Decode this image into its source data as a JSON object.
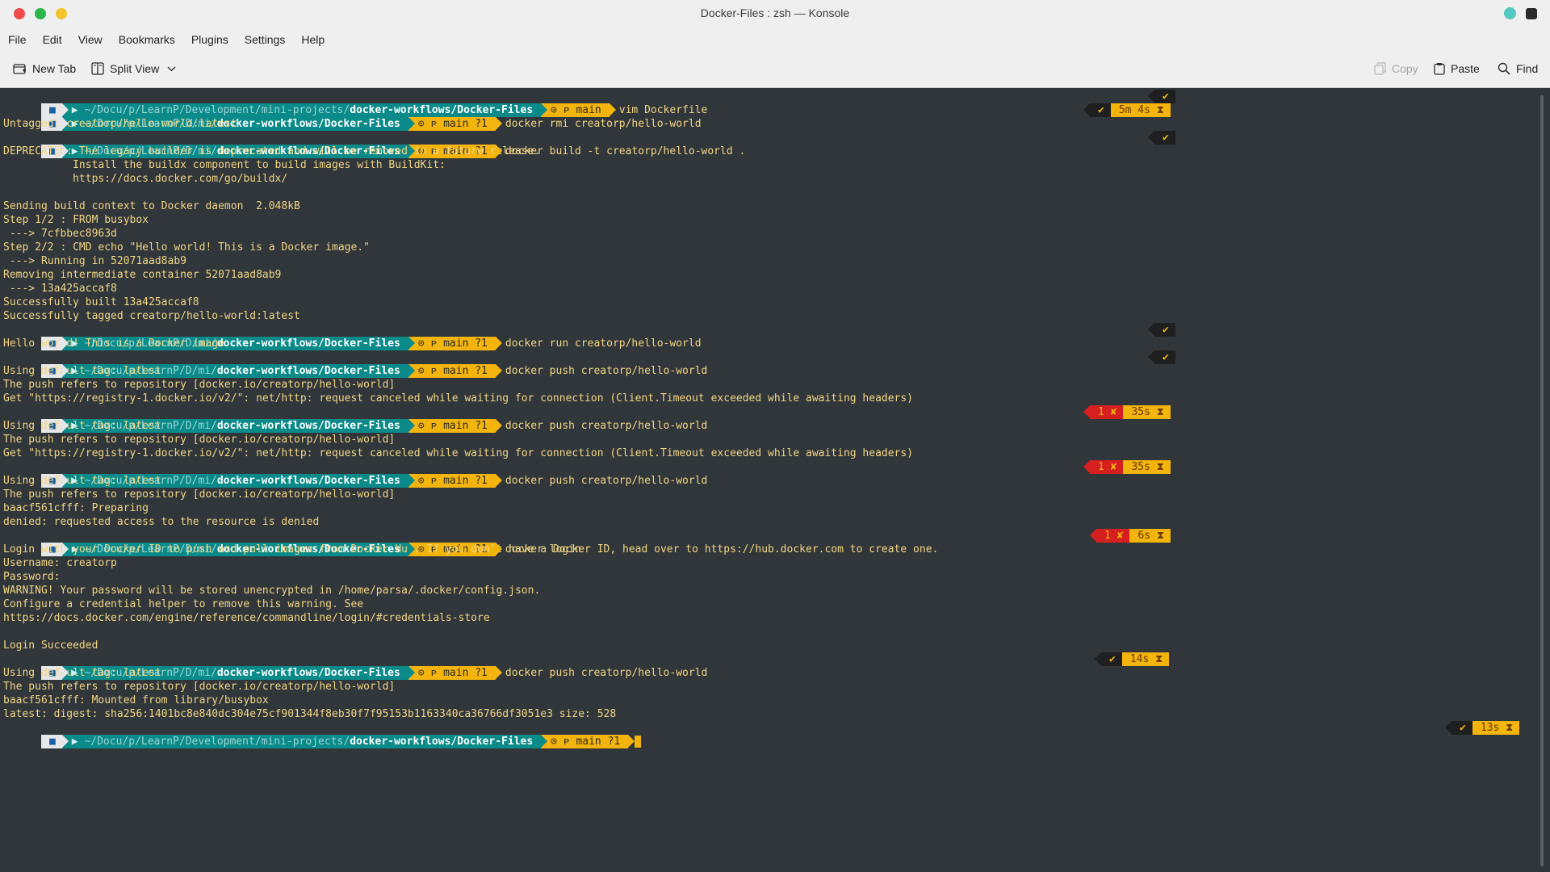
{
  "window": {
    "title": "Docker-Files : zsh — Konsole"
  },
  "menu": [
    "File",
    "Edit",
    "View",
    "Bookmarks",
    "Plugins",
    "Settings",
    "Help"
  ],
  "toolbar": {
    "new_tab": "New Tab",
    "split_view": "Split View",
    "copy": "Copy",
    "paste": "Paste",
    "find": "Find"
  },
  "prompt": {
    "os_icon": "■",
    "folder_icon": "▶",
    "short_dim1": "~/Docu/p/LearnP/D/mi/",
    "short_bold": "docker-workflows/Docker-Files",
    "long_dim1": "~/Docu/p/LearnP/Development/mini-projects/",
    "long_bold": "docker-workflows/Docker-Files",
    "git_main": "⊙ ᴘ main",
    "git_main_dirty": "⊙ ᴘ main ?1"
  },
  "status": {
    "ok": "✔",
    "err": "1 ✘",
    "t_5m4s": "5m 4s ⧗",
    "t_35s": "35s ⧗",
    "t_6s": "6s ⧗",
    "t_14s": "14s ⧗",
    "t_13s": "13s ⧗"
  },
  "lines": {
    "c1": "vim Dockerfile",
    "c2": "docker rmi creatorp/hello-world",
    "o2": "Untagged: creatorp/hello-world:latest",
    "c3": "docker build -t creatorp/hello-world .",
    "o3": [
      "DEPRECATED: The legacy builder is deprecated and will be removed in a future release.",
      "           Install the buildx component to build images with BuildKit:",
      "           https://docs.docker.com/go/buildx/",
      "",
      "Sending build context to Docker daemon  2.048kB",
      "Step 1/2 : FROM busybox",
      " ---> 7cfbbec8963d",
      "Step 2/2 : CMD echo \"Hello world! This is a Docker image.\"",
      " ---> Running in 52071aad8ab9",
      "Removing intermediate container 52071aad8ab9",
      " ---> 13a425accaf8",
      "Successfully built 13a425accaf8",
      "Successfully tagged creatorp/hello-world:latest"
    ],
    "c4": "docker run creatorp/hello-world",
    "o4": "Hello world! This is a Docker image.",
    "c5": "docker push creatorp/hello-world",
    "o5": [
      "Using default tag: latest",
      "The push refers to repository [docker.io/creatorp/hello-world]",
      "Get \"https://registry-1.docker.io/v2/\": net/http: request canceled while waiting for connection (Client.Timeout exceeded while awaiting headers)"
    ],
    "c6": "docker push creatorp/hello-world",
    "o6": [
      "Using default tag: latest",
      "The push refers to repository [docker.io/creatorp/hello-world]",
      "Get \"https://registry-1.docker.io/v2/\": net/http: request canceled while waiting for connection (Client.Timeout exceeded while awaiting headers)"
    ],
    "c7": "docker push creatorp/hello-world",
    "o7": [
      "Using default tag: latest",
      "The push refers to repository [docker.io/creatorp/hello-world]",
      "baacf561cfff: Preparing",
      "denied: requested access to the resource is denied"
    ],
    "c8": "docker login",
    "o8": [
      "Login with your Docker ID to push and pull images from Docker Hub. If you don't have a Docker ID, head over to https://hub.docker.com to create one.",
      "Username: creatorp",
      "Password:",
      "WARNING! Your password will be stored unencrypted in /home/parsa/.docker/config.json.",
      "Configure a credential helper to remove this warning. See",
      "https://docs.docker.com/engine/reference/commandline/login/#credentials-store",
      "",
      "Login Succeeded"
    ],
    "c9": "docker push creatorp/hello-world",
    "o9": [
      "Using default tag: latest",
      "The push refers to repository [docker.io/creatorp/hello-world]",
      "baacf561cfff: Mounted from library/busybox",
      "latest: digest: sha256:1401bc8e840dc304e75cf901344f8eb30f7f95153b1163340ca36766df3051e3 size: 528"
    ]
  }
}
